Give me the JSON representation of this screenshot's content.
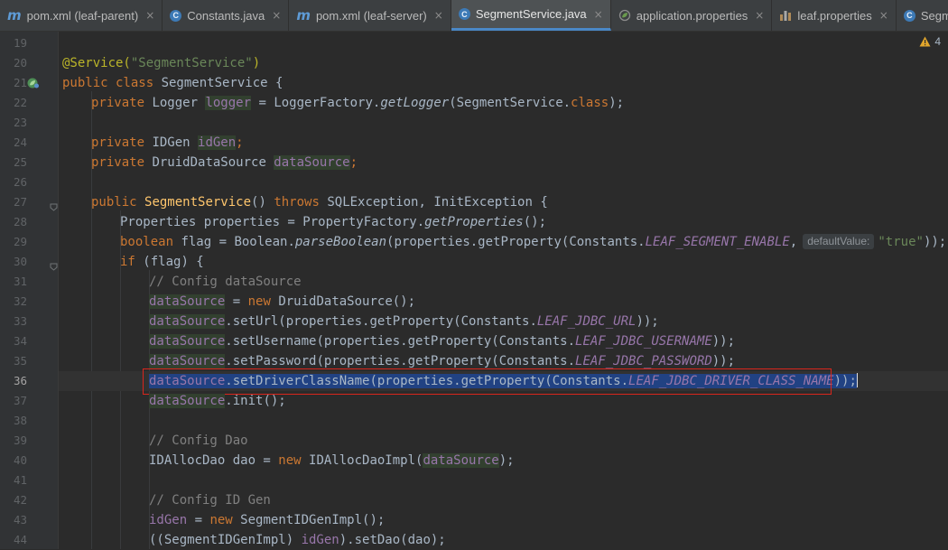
{
  "tabs": [
    {
      "icon": "maven-icon",
      "label": "pom.xml (leaf-parent)",
      "active": false
    },
    {
      "icon": "java-class-icon",
      "label": "Constants.java",
      "active": false
    },
    {
      "icon": "maven-icon",
      "label": "pom.xml (leaf-server)",
      "active": false
    },
    {
      "icon": "java-class-icon",
      "label": "SegmentService.java",
      "active": true
    },
    {
      "icon": "spring-properties-icon",
      "label": "application.properties",
      "active": false
    },
    {
      "icon": "properties-file-icon",
      "label": "leaf.properties",
      "active": false
    },
    {
      "icon": "java-class-icon",
      "label": "Segmen",
      "active": false
    }
  ],
  "tab_close_glyph": "×",
  "warnings": {
    "icon": "warning-triangle-icon",
    "count": "4"
  },
  "gutter": {
    "line_numbers": [
      "19",
      "20",
      "21",
      "22",
      "23",
      "24",
      "25",
      "26",
      "27",
      "28",
      "29",
      "30",
      "31",
      "32",
      "33",
      "34",
      "35",
      "36",
      "37",
      "38",
      "39",
      "40",
      "41",
      "42",
      "43",
      "44"
    ],
    "current_line": "36",
    "bean_icon_line": "21"
  },
  "code": {
    "l20": {
      "ann": "@Service(",
      "str": "\"SegmentService\"",
      "close": ")"
    },
    "l21": {
      "kw": "public class ",
      "name": "SegmentService {"
    },
    "l22": {
      "kw": "private ",
      "type": "Logger ",
      "field": "logger",
      "eq": " = LoggerFactory.",
      "mth": "getLogger",
      "rest1": "(SegmentService.",
      "kw2": "class",
      "rest2": ");"
    },
    "l24": {
      "kw": "private ",
      "type": "IDGen ",
      "field": "idGen",
      "end": ";"
    },
    "l25": {
      "kw": "private ",
      "type": "DruidDataSource ",
      "field": "dataSource",
      "end": ";"
    },
    "l27": {
      "kw": "public ",
      "ctor": "SegmentService",
      "p": "() ",
      "kw2": "throws ",
      "rest": "SQLException, InitException {"
    },
    "l28": {
      "a": "Properties properties = PropertyFactory.",
      "mth": "getProperties",
      "b": "();"
    },
    "l29": {
      "kw": "boolean ",
      "a": "flag = Boolean.",
      "mth": "parseBoolean",
      "b": "(properties.getProperty(Constants.",
      "const": "LEAF_SEGMENT_ENABLE",
      "c": ",",
      "hint": "defaultValue:",
      "str": "\"true\"",
      "d": "));"
    },
    "l30": {
      "kw": "if ",
      "a": "(flag) {"
    },
    "l31": {
      "cmt": "// Config dataSource"
    },
    "l32": {
      "field": "dataSource",
      "a": " = ",
      "kw": "new ",
      "b": "DruidDataSource();"
    },
    "l33": {
      "field": "dataSource",
      "a": ".setUrl(properties.getProperty(Constants.",
      "const": "LEAF_JDBC_URL",
      "b": "));"
    },
    "l34": {
      "field": "dataSource",
      "a": ".setUsername(properties.getProperty(Constants.",
      "const": "LEAF_JDBC_USERNAME",
      "b": "));"
    },
    "l35": {
      "field": "dataSource",
      "a": ".setPassword(properties.getProperty(Constants.",
      "const": "LEAF_JDBC_PASSWORD",
      "b": "));"
    },
    "l36": {
      "field": "dataSource",
      "a": ".setDriverClassName(properties.getProperty(Constants.",
      "const": "LEAF_JDBC_DRIVER_CLASS_NAME",
      "b": "));"
    },
    "l37": {
      "field": "dataSource",
      "a": ".init();"
    },
    "l39": {
      "cmt": "// Config Dao"
    },
    "l40": {
      "a": "IDAllocDao dao = ",
      "kw": "new ",
      "b": "IDAllocDaoImpl(",
      "field": "dataSource",
      "c": ");"
    },
    "l42": {
      "cmt": "// Config ID Gen"
    },
    "l43": {
      "field": "idGen",
      "a": " = ",
      "kw": "new ",
      "b": "SegmentIDGenImpl();"
    },
    "l44": {
      "a": "((SegmentIDGenImpl) ",
      "field": "idGen",
      "b": ").setDao(dao);"
    }
  },
  "colors": {
    "selection": "#214283",
    "highlight_box": "#d9261c",
    "active_tab_underline": "#4a88c7"
  }
}
